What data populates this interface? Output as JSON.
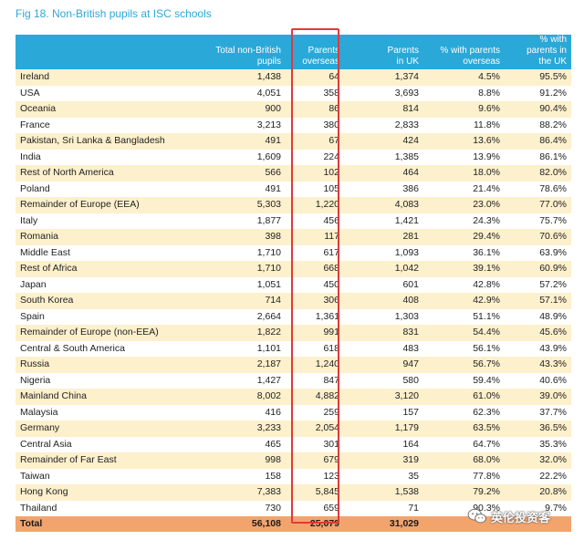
{
  "figure": {
    "title": "Fig 18. Non-British pupils at ISC schools"
  },
  "table": {
    "headers": [
      "",
      "Total non-British\npupils",
      "Parents\noverseas",
      "Parents\nin UK",
      "% with parents\noverseas",
      "% with parents in\nthe UK"
    ],
    "rows": [
      [
        "Ireland",
        "1,438",
        "64",
        "1,374",
        "4.5%",
        "95.5%"
      ],
      [
        "USA",
        "4,051",
        "358",
        "3,693",
        "8.8%",
        "91.2%"
      ],
      [
        "Oceania",
        "900",
        "86",
        "814",
        "9.6%",
        "90.4%"
      ],
      [
        "France",
        "3,213",
        "380",
        "2,833",
        "11.8%",
        "88.2%"
      ],
      [
        "Pakistan, Sri Lanka & Bangladesh",
        "491",
        "67",
        "424",
        "13.6%",
        "86.4%"
      ],
      [
        "India",
        "1,609",
        "224",
        "1,385",
        "13.9%",
        "86.1%"
      ],
      [
        "Rest of North America",
        "566",
        "102",
        "464",
        "18.0%",
        "82.0%"
      ],
      [
        "Poland",
        "491",
        "105",
        "386",
        "21.4%",
        "78.6%"
      ],
      [
        "Remainder of Europe (EEA)",
        "5,303",
        "1,220",
        "4,083",
        "23.0%",
        "77.0%"
      ],
      [
        "Italy",
        "1,877",
        "456",
        "1,421",
        "24.3%",
        "75.7%"
      ],
      [
        "Romania",
        "398",
        "117",
        "281",
        "29.4%",
        "70.6%"
      ],
      [
        "Middle East",
        "1,710",
        "617",
        "1,093",
        "36.1%",
        "63.9%"
      ],
      [
        "Rest of Africa",
        "1,710",
        "668",
        "1,042",
        "39.1%",
        "60.9%"
      ],
      [
        "Japan",
        "1,051",
        "450",
        "601",
        "42.8%",
        "57.2%"
      ],
      [
        "South Korea",
        "714",
        "306",
        "408",
        "42.9%",
        "57.1%"
      ],
      [
        "Spain",
        "2,664",
        "1,361",
        "1,303",
        "51.1%",
        "48.9%"
      ],
      [
        "Remainder of Europe (non-EEA)",
        "1,822",
        "991",
        "831",
        "54.4%",
        "45.6%"
      ],
      [
        "Central & South America",
        "1,101",
        "618",
        "483",
        "56.1%",
        "43.9%"
      ],
      [
        "Russia",
        "2,187",
        "1,240",
        "947",
        "56.7%",
        "43.3%"
      ],
      [
        "Nigeria",
        "1,427",
        "847",
        "580",
        "59.4%",
        "40.6%"
      ],
      [
        "Mainland China",
        "8,002",
        "4,882",
        "3,120",
        "61.0%",
        "39.0%"
      ],
      [
        "Malaysia",
        "416",
        "259",
        "157",
        "62.3%",
        "37.7%"
      ],
      [
        "Germany",
        "3,233",
        "2,054",
        "1,179",
        "63.5%",
        "36.5%"
      ],
      [
        "Central Asia",
        "465",
        "301",
        "164",
        "64.7%",
        "35.3%"
      ],
      [
        "Remainder of Far East",
        "998",
        "679",
        "319",
        "68.0%",
        "32.0%"
      ],
      [
        "Taiwan",
        "158",
        "123",
        "35",
        "77.8%",
        "22.2%"
      ],
      [
        "Hong Kong",
        "7,383",
        "5,845",
        "1,538",
        "79.2%",
        "20.8%"
      ],
      [
        "Thailand",
        "730",
        "659",
        "71",
        "90.3%",
        "9.7%"
      ]
    ],
    "total": [
      "Total",
      "56,108",
      "25,079",
      "31,029",
      "",
      ""
    ]
  },
  "watermark": {
    "text": "英伦投资客"
  },
  "colors": {
    "header_bg": "#2aa8d8",
    "row_alt_bg": "#fdf0cc",
    "total_bg": "#f3a46d",
    "highlight_border": "#e03a3a",
    "title_color": "#2aa8d8"
  }
}
